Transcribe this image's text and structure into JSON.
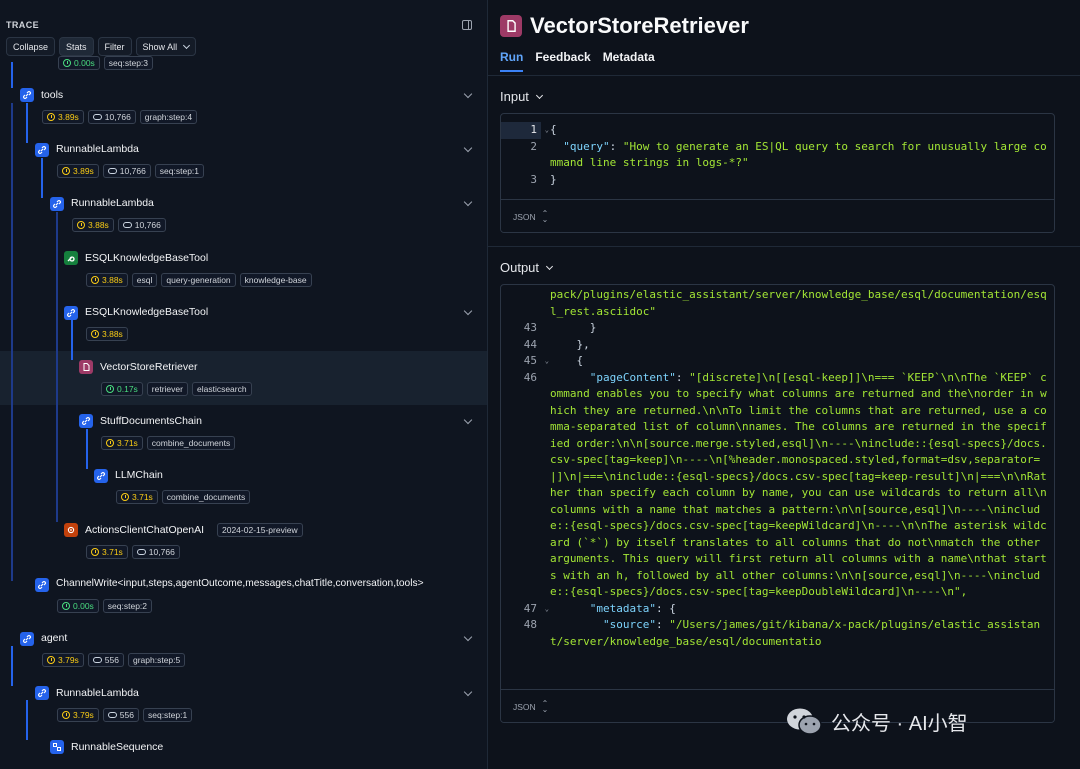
{
  "trace": {
    "title": "TRACE",
    "toolbar": {
      "collapse": "Collapse",
      "stats": "Stats",
      "filter": "Filter",
      "show_all": "Show All"
    },
    "top_partial": {
      "time": "0.00s",
      "tag": "seq:step:3"
    },
    "nodes": [
      {
        "name": "tools",
        "icon": "link-icon",
        "time": "3.89s",
        "tokens": "10,766",
        "tags": [
          "graph:step:4"
        ]
      },
      {
        "name": "RunnableLambda",
        "icon": "link-icon",
        "time": "3.89s",
        "tokens": "10,766",
        "tags": [
          "seq:step:1"
        ]
      },
      {
        "name": "RunnableLambda",
        "icon": "link-icon",
        "time": "3.88s",
        "tokens": "10,766",
        "tags": []
      },
      {
        "name": "ESQLKnowledgeBaseTool",
        "icon": "wrench-icon",
        "time": "3.88s",
        "tags": [
          "esql",
          "query-generation",
          "knowledge-base"
        ]
      },
      {
        "name": "ESQLKnowledgeBaseTool",
        "icon": "link-icon",
        "time": "3.88s",
        "tags": []
      },
      {
        "name": "VectorStoreRetriever",
        "icon": "document-icon",
        "time": "0.17s",
        "tags": [
          "retriever",
          "elasticsearch"
        ]
      },
      {
        "name": "StuffDocumentsChain",
        "icon": "link-icon",
        "time": "3.71s",
        "tags": [
          "combine_documents"
        ]
      },
      {
        "name": "LLMChain",
        "icon": "link-icon",
        "time": "3.71s",
        "tags": [
          "combine_documents"
        ]
      },
      {
        "name": "ActionsClientChatOpenAI",
        "icon": "llm-icon",
        "badge": "2024-02-15-preview",
        "time": "3.71s",
        "tokens": "10,766",
        "tags": []
      },
      {
        "name": "ChannelWrite<input,steps,agentOutcome,messages,chatTitle,conversation,tools>",
        "icon": "link-icon",
        "time": "0.00s",
        "tags": [
          "seq:step:2"
        ]
      },
      {
        "name": "agent",
        "icon": "link-icon",
        "time": "3.79s",
        "tokens": "556",
        "tags": [
          "graph:step:5"
        ]
      },
      {
        "name": "RunnableLambda",
        "icon": "link-icon",
        "time": "3.79s",
        "tokens": "556",
        "tags": [
          "seq:step:1"
        ]
      },
      {
        "name": "RunnableSequence",
        "icon": "sequence-icon"
      }
    ]
  },
  "main": {
    "title": "VectorStoreRetriever",
    "tabs": [
      "Run",
      "Feedback",
      "Metadata"
    ],
    "input": {
      "label": "Input",
      "format": "JSON",
      "lines": [
        {
          "num": "1",
          "fold": true,
          "content": "{"
        },
        {
          "num": "2",
          "key": "\"query\"",
          "content": "\"How to generate an ES|QL query to search for unusually large command line strings in logs-*?\""
        },
        {
          "num": "3",
          "content": "}"
        }
      ]
    },
    "output": {
      "label": "Output",
      "format": "JSON",
      "lines": [
        {
          "num": "",
          "content": "pack/plugins/elastic_assistant/server/knowledge_base/esql/documentation/esql_rest.asciidoc\""
        },
        {
          "num": "43",
          "content": "      }"
        },
        {
          "num": "44",
          "content": "    },"
        },
        {
          "num": "45",
          "fold": true,
          "content": "    {"
        },
        {
          "num": "46",
          "key": "\"pageContent\"",
          "content": "\"[discrete]\\n[[esql-keep]]\\n=== `KEEP`\\n\\nThe `KEEP` command enables you to specify what columns are returned and the\\norder in which they are returned.\\n\\nTo limit the columns that are returned, use a comma-separated list of column\\nnames. The columns are returned in the specified order:\\n\\n[source.merge.styled,esql]\\n----\\ninclude::{esql-specs}/docs.csv-spec[tag=keep]\\n----\\n[%header.monospaced.styled,format=dsv,separator=|]\\n|===\\ninclude::{esql-specs}/docs.csv-spec[tag=keep-result]\\n|===\\n\\nRather than specify each column by name, you can use wildcards to return all\\ncolumns with a name that matches a pattern:\\n\\n[source,esql]\\n----\\ninclude::{esql-specs}/docs.csv-spec[tag=keepWildcard]\\n----\\n\\nThe asterisk wildcard (`*`) by itself translates to all columns that do not\\nmatch the other arguments. This query will first return all columns with a name\\nthat starts with an h, followed by all other columns:\\n\\n[source,esql]\\n----\\ninclude::{esql-specs}/docs.csv-spec[tag=keepDoubleWildcard]\\n----\\n\","
        },
        {
          "num": "47",
          "fold": true,
          "key": "\"metadata\"",
          "content": "{"
        },
        {
          "num": "48",
          "key": "\"source\"",
          "content": "\"/Users/james/git/kibana/x-pack/plugins/elastic_assistant/server/knowledge_base/esql/documentatio"
        }
      ]
    }
  },
  "watermark": {
    "text": "公众号 · AI小智"
  },
  "colors": {
    "accent": "#3b82f6",
    "link_icon": "#2563eb",
    "tool_icon": "#15803d",
    "retriever_icon": "#9d3a66",
    "llm_icon": "#c2410c",
    "time_yellow": "#facc15",
    "time_green": "#4ade80",
    "json_key": "#7dd3fc",
    "json_string": "#a3e635"
  }
}
